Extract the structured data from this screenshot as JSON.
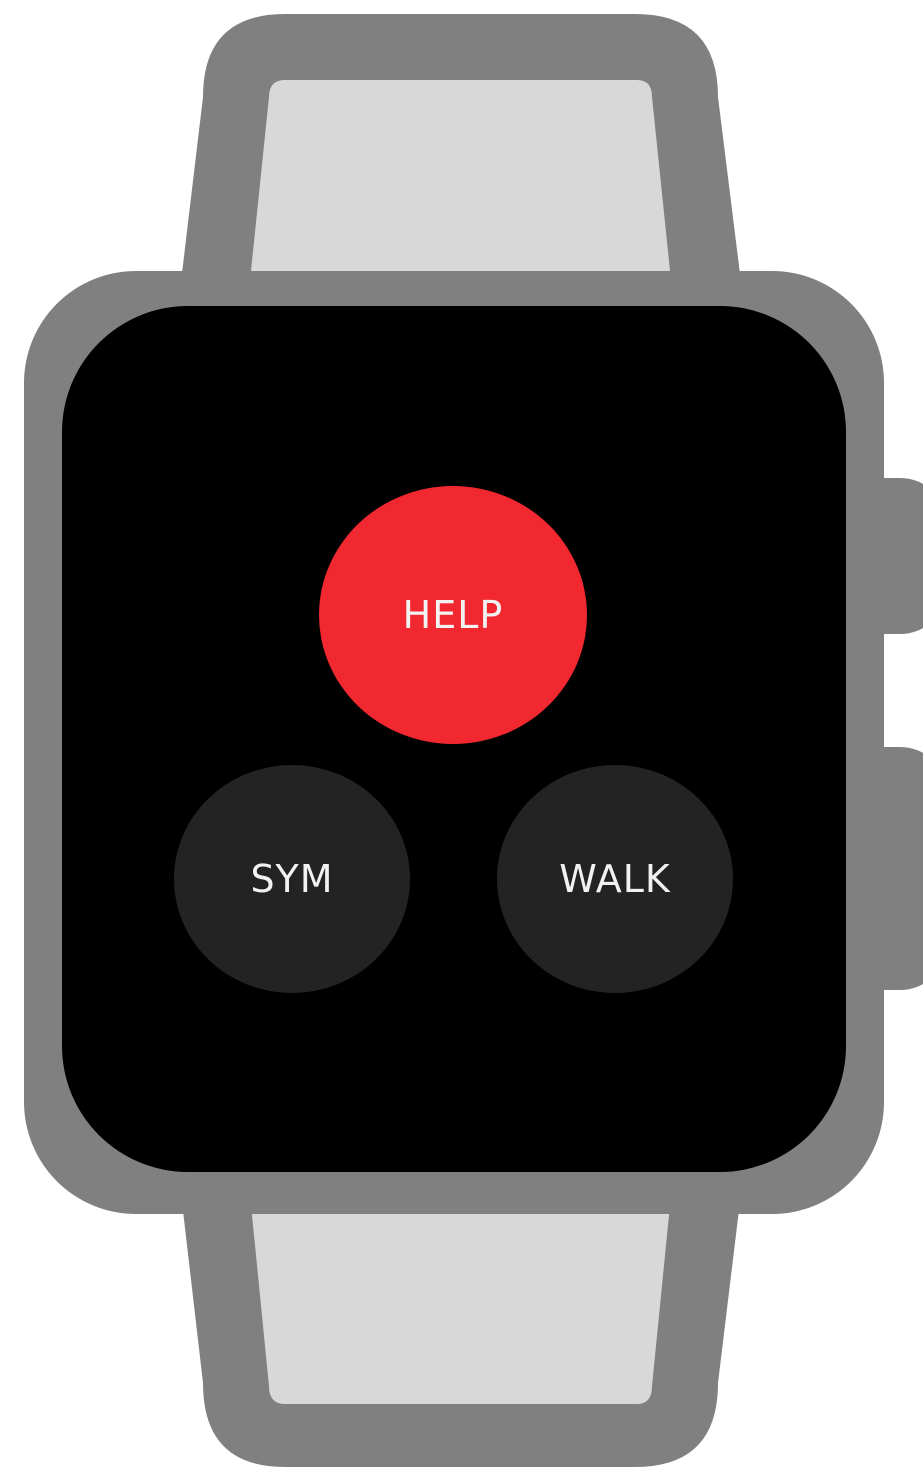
{
  "colors": {
    "case": "#808080",
    "band": "#d8d8d8",
    "screen": "#000000",
    "help_accent": "#f1282f",
    "secondary_button": "#232323",
    "label_text": "#f2f2f2"
  },
  "buttons": {
    "help": {
      "label": "HELP",
      "color": "#f1282f"
    },
    "sym": {
      "label": "SYM",
      "color": "#232323"
    },
    "walk": {
      "label": "WALK",
      "color": "#232323"
    }
  }
}
